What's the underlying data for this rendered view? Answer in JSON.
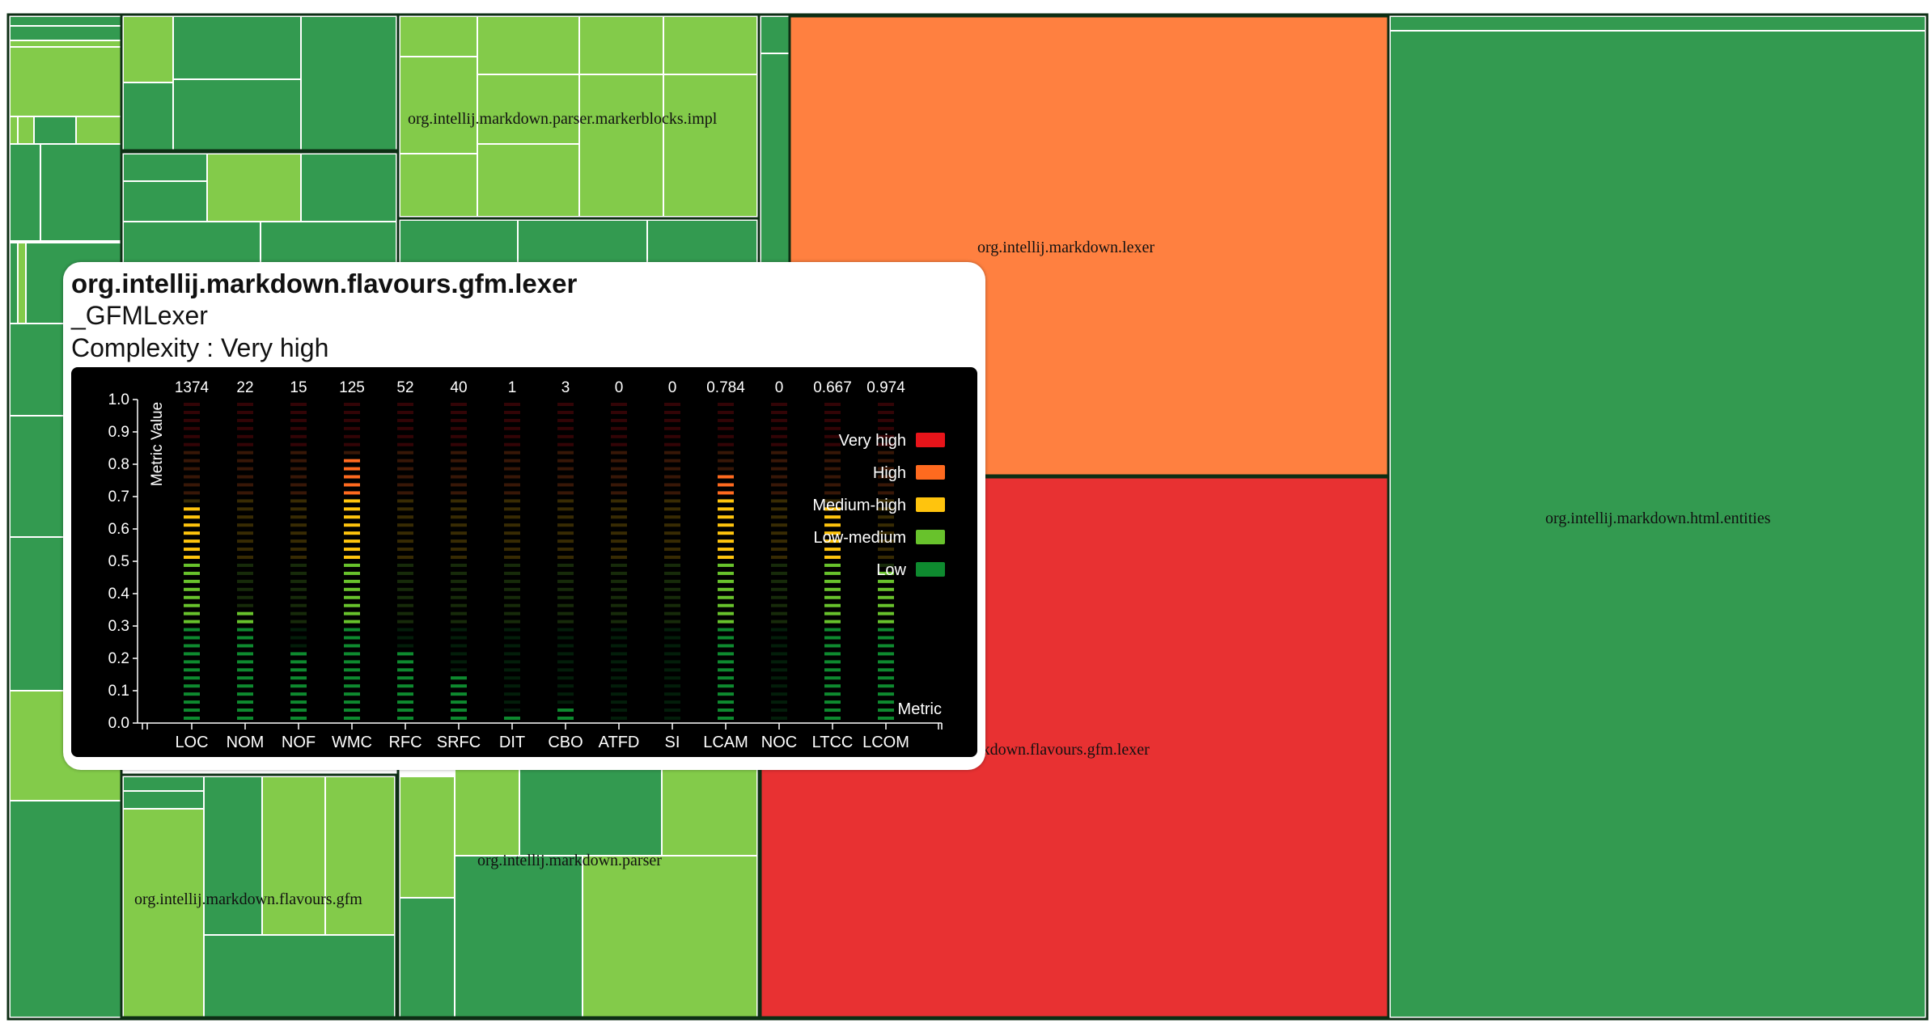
{
  "treemap": {
    "packages": [
      {
        "name": "org.intellij.markdown.parser.markerblocks.impl"
      },
      {
        "name": "org.intellij.markdown.lexer"
      },
      {
        "name": "org.intellij.markdown.html.entities"
      },
      {
        "name": "org.intellij.markdown.flavours.gfm.lexer"
      },
      {
        "name": "org.intellij.markdown.parser"
      },
      {
        "name": "org.intellij.markdown.flavours.gfm"
      }
    ],
    "colors": {
      "low": "#339a50",
      "low_medium": "#83cb4a",
      "high": "#ff8040",
      "very_high": "#e83132",
      "border": "#0d2e14"
    }
  },
  "tooltip": {
    "package": "org.intellij.markdown.flavours.gfm.lexer",
    "class_name": "_GFMLexer",
    "complexity_label": "Complexity : ",
    "complexity_value": "Very high"
  },
  "chart_data": {
    "type": "bar",
    "ylabel": "Metric Value",
    "xlabel": "Metric",
    "ylim": [
      0,
      1
    ],
    "yticks": [
      "0.0",
      "0.1",
      "0.2",
      "0.3",
      "0.4",
      "0.5",
      "0.6",
      "0.7",
      "0.8",
      "0.9",
      "1.0"
    ],
    "categories": [
      "LOC",
      "NOM",
      "NOF",
      "WMC",
      "RFC",
      "SRFC",
      "DIT",
      "CBO",
      "ATFD",
      "SI",
      "LCAM",
      "NOC",
      "LTCC",
      "LCOM"
    ],
    "raw_values": [
      "1374",
      "22",
      "15",
      "125",
      "52",
      "40",
      "1",
      "3",
      "0",
      "0",
      "0.784",
      "0",
      "0.667",
      "0.974"
    ],
    "values": [
      0.68,
      0.35,
      0.23,
      0.83,
      0.22,
      0.15,
      0.02,
      0.05,
      0.0,
      0.0,
      0.77,
      0.0,
      0.68,
      0.47
    ],
    "legend": [
      {
        "label": "Very high",
        "color": "#e8141a"
      },
      {
        "label": "High",
        "color": "#ff6a1f"
      },
      {
        "label": "Medium-high",
        "color": "#ffc40d"
      },
      {
        "label": "Low-medium",
        "color": "#68c22c"
      },
      {
        "label": "Low",
        "color": "#0e8a2f"
      }
    ],
    "legend_position": "top-right"
  }
}
